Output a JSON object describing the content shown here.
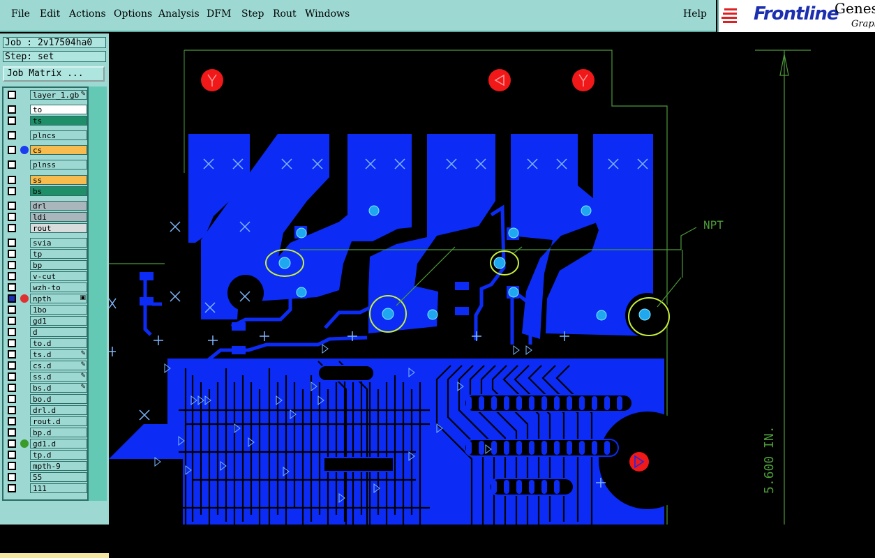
{
  "menu": {
    "items": [
      "File",
      "Edit",
      "Actions",
      "Options",
      "Analysis",
      "DFM",
      "Step",
      "Rout",
      "Windows"
    ],
    "help": "Help"
  },
  "logo": {
    "brand": "Frontline",
    "product": "Genes",
    "sub": "Graph"
  },
  "job": {
    "job_label": "Job : 2v17504ha0",
    "step_label": "Step: set",
    "matrix_button": "Job Matrix ..."
  },
  "layers": [
    {
      "name": "layer_1.gb",
      "color": "#9dd9d2",
      "mark": "✎"
    },
    {
      "name": "to",
      "color": "#ffffff"
    },
    {
      "name": "ts",
      "color": "#1f8f6a"
    },
    {
      "name": "plncs",
      "color": "#9dd9d2"
    },
    {
      "name": "cs",
      "color": "#f7bb4e",
      "dot": "#1b3cf0"
    },
    {
      "name": "plnss",
      "color": "#9dd9d2"
    },
    {
      "name": "ss",
      "color": "#f7bb4e"
    },
    {
      "name": "bs",
      "color": "#1f8f6a"
    },
    {
      "name": "drl",
      "color": "#a9b7bd"
    },
    {
      "name": "ldi",
      "color": "#a9b7bd"
    },
    {
      "name": "rout",
      "color": "#d8dcdc"
    },
    {
      "name": "svia",
      "color": "#9dd9d2"
    },
    {
      "name": "tp",
      "color": "#9dd9d2"
    },
    {
      "name": "bp",
      "color": "#9dd9d2"
    },
    {
      "name": "v-cut",
      "color": "#9dd9d2"
    },
    {
      "name": "wzh-to",
      "color": "#9dd9d2"
    },
    {
      "name": "npth",
      "color": "#9dd9d2",
      "checked": true,
      "dot": "#e03030",
      "mark": "▣"
    },
    {
      "name": "1bo",
      "color": "#9dd9d2"
    },
    {
      "name": "gd1",
      "color": "#9dd9d2"
    },
    {
      "name": "d",
      "color": "#9dd9d2"
    },
    {
      "name": "to.d",
      "color": "#9dd9d2"
    },
    {
      "name": "ts.d",
      "color": "#9dd9d2",
      "mark": "✎"
    },
    {
      "name": "cs.d",
      "color": "#9dd9d2",
      "mark": "✎"
    },
    {
      "name": "ss.d",
      "color": "#9dd9d2",
      "mark": "✎"
    },
    {
      "name": "bs.d",
      "color": "#9dd9d2",
      "mark": "✎"
    },
    {
      "name": "bo.d",
      "color": "#9dd9d2"
    },
    {
      "name": "drl.d",
      "color": "#9dd9d2"
    },
    {
      "name": "rout.d",
      "color": "#9dd9d2"
    },
    {
      "name": "bp.d",
      "color": "#9dd9d2"
    },
    {
      "name": "gd1.d",
      "color": "#9dd9d2",
      "dot": "#3a9a2a"
    },
    {
      "name": "tp.d",
      "color": "#9dd9d2"
    },
    {
      "name": "mpth-9",
      "color": "#9dd9d2"
    },
    {
      "name": "55",
      "color": "#9dd9d2"
    },
    {
      "name": "111",
      "color": "#9dd9d2"
    }
  ],
  "canvas": {
    "annotation": "NPT",
    "dimension": "5.600 IN.",
    "colors": {
      "copper": "#0c2cf5",
      "pad": "#1fa8f0",
      "outline": "#4d9a3a",
      "highlight": "#c8f03a",
      "npth": "#f01818",
      "background": "#000000"
    }
  }
}
